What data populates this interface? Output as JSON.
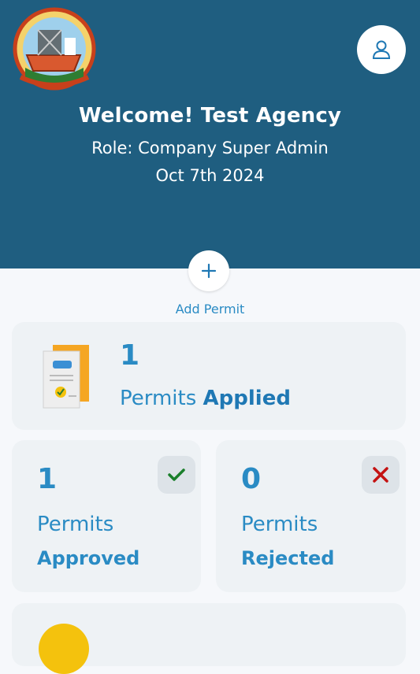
{
  "header": {
    "welcome": "Welcome! Test Agency",
    "role": "Role: Company Super Admin",
    "date": "Oct 7th 2024",
    "bg_color": "#1f5e80"
  },
  "actions": {
    "add_permit_label": "Add Permit"
  },
  "stats": {
    "applied": {
      "count": "1",
      "word": "Permits ",
      "status": "Applied"
    },
    "approved": {
      "count": "1",
      "word": "Permits",
      "status": "Approved"
    },
    "rejected": {
      "count": "0",
      "word": "Permits",
      "status": "Rejected"
    }
  },
  "colors": {
    "accent": "#2a8bc4",
    "approved_check": "#1a7f2b",
    "rejected_x": "#c41212"
  },
  "icons": [
    "logo",
    "user-icon",
    "plus-icon",
    "document-icon",
    "check-icon",
    "x-icon"
  ]
}
